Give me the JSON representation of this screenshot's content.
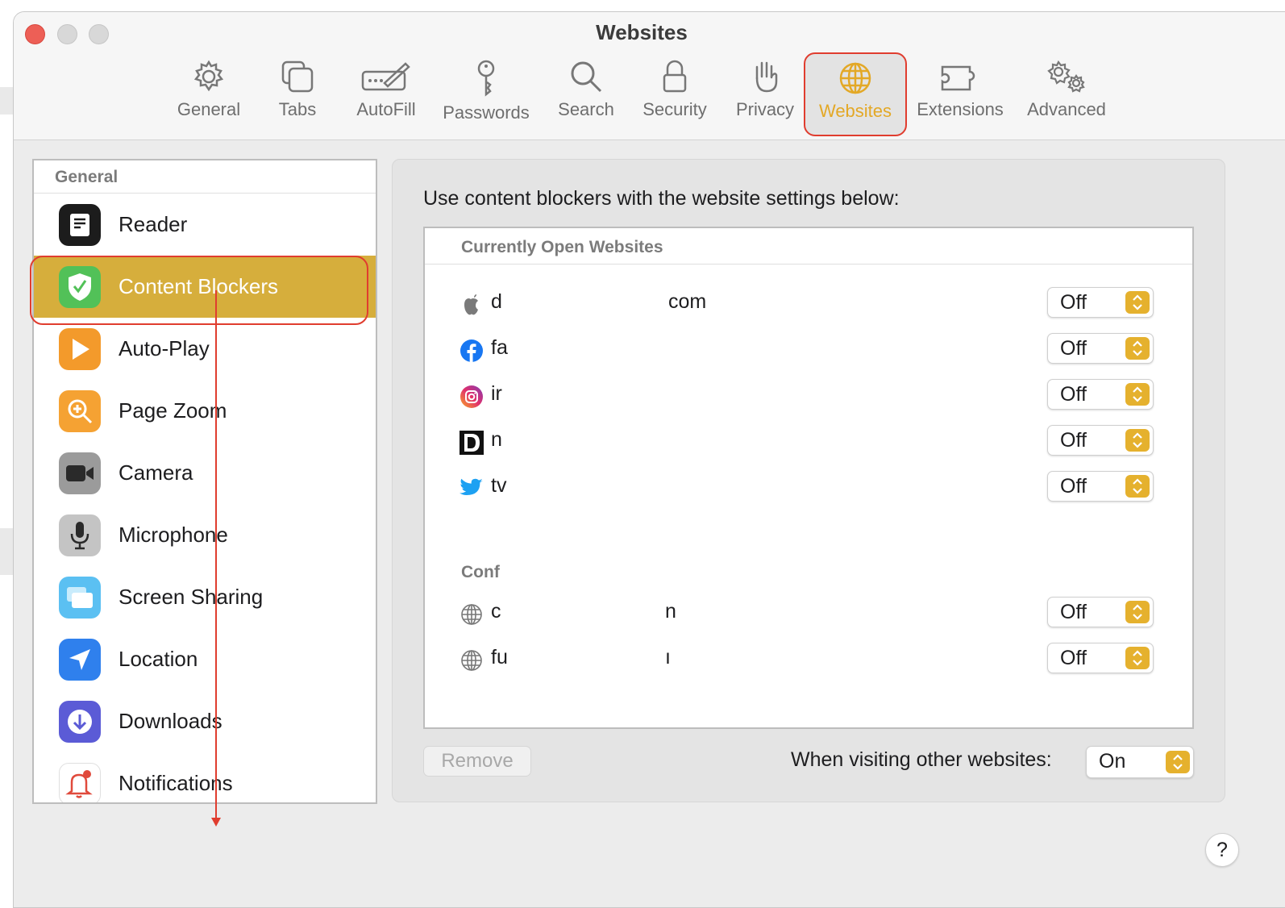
{
  "window": {
    "title": "Websites"
  },
  "toolbar": {
    "items": [
      {
        "label": "General",
        "icon": "gear-icon"
      },
      {
        "label": "Tabs",
        "icon": "tabs-icon"
      },
      {
        "label": "AutoFill",
        "icon": "autofill-icon"
      },
      {
        "label": "Passwords",
        "icon": "key-icon"
      },
      {
        "label": "Search",
        "icon": "search-icon"
      },
      {
        "label": "Security",
        "icon": "lock-icon"
      },
      {
        "label": "Privacy",
        "icon": "hand-icon"
      },
      {
        "label": "Websites",
        "icon": "globe-icon",
        "active": true
      },
      {
        "label": "Extensions",
        "icon": "puzzle-icon"
      },
      {
        "label": "Advanced",
        "icon": "gears-icon"
      }
    ]
  },
  "sidebar": {
    "header": "General",
    "items": [
      {
        "label": "Reader",
        "icon": "reader-icon"
      },
      {
        "label": "Content Blockers",
        "icon": "shield-check-icon",
        "selected": true
      },
      {
        "label": "Auto-Play",
        "icon": "play-icon"
      },
      {
        "label": "Page Zoom",
        "icon": "zoom-icon"
      },
      {
        "label": "Camera",
        "icon": "camera-icon"
      },
      {
        "label": "Microphone",
        "icon": "microphone-icon"
      },
      {
        "label": "Screen Sharing",
        "icon": "screen-sharing-icon"
      },
      {
        "label": "Location",
        "icon": "location-icon"
      },
      {
        "label": "Downloads",
        "icon": "download-icon"
      },
      {
        "label": "Notifications",
        "icon": "bell-icon"
      }
    ]
  },
  "main": {
    "heading": "Use content blockers with the website settings below:",
    "open_header": "Currently Open Websites",
    "open_sites": [
      {
        "start": "d",
        "end": "com",
        "icon": "apple-icon",
        "value": "Off"
      },
      {
        "start": "fa",
        "end": "",
        "icon": "facebook-icon",
        "value": "Off"
      },
      {
        "start": "ir",
        "end": "",
        "icon": "instagram-icon",
        "value": "Off"
      },
      {
        "start": "n",
        "end": "",
        "icon": "d-logo-icon",
        "value": "Off"
      },
      {
        "start": "tv",
        "end": "",
        "icon": "twitter-icon",
        "value": "Off"
      }
    ],
    "configured_header": "Conf",
    "configured_sites": [
      {
        "start": "c",
        "end": "n",
        "icon": "globe-icon",
        "value": "Off"
      },
      {
        "start": "fu",
        "end": "ı",
        "icon": "globe-icon",
        "value": "Off"
      }
    ],
    "remove_label": "Remove",
    "other_label": "When visiting other websites:",
    "other_value": "On"
  },
  "help_label": "?",
  "colors": {
    "accent": "#e5b12e",
    "selection": "#d6ae3c",
    "annotation": "#e03d2f"
  }
}
